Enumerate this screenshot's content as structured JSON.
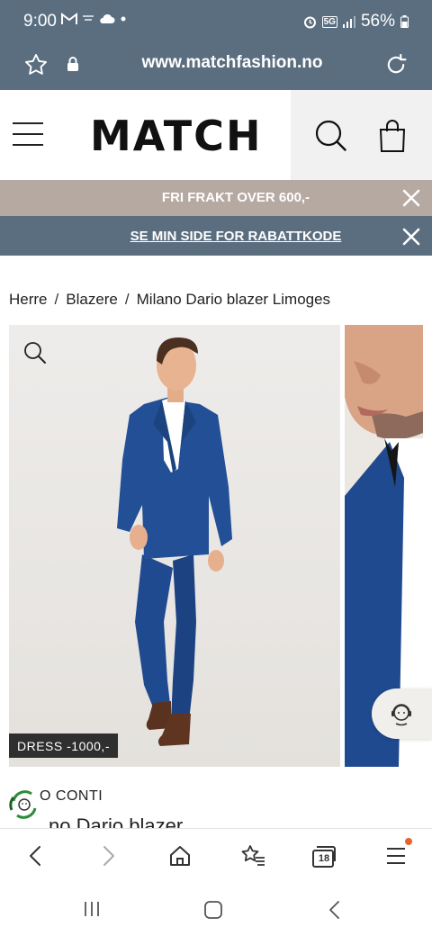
{
  "status_bar": {
    "time": "9:00",
    "battery": "56%",
    "network": "5G"
  },
  "url_bar": {
    "url": "www.matchfashion.no"
  },
  "header": {
    "logo": "MATCH"
  },
  "promos": [
    {
      "text": "FRI FRAKT OVER 600,-"
    },
    {
      "text": "SE MIN SIDE FOR RABATTKODE"
    }
  ],
  "breadcrumb": {
    "items": [
      "Herre",
      "Blazere",
      "Milano Dario blazer Limoges"
    ],
    "separator": "/"
  },
  "product": {
    "badge": "DRESS -1000,-",
    "brand": "O CONTI",
    "title": "no Dario blazer"
  },
  "colors": {
    "top_bar": "#5b6e80",
    "promo_bar": "#b6a9a1",
    "suit_blue": "#1f4a8f",
    "notification_dot": "#e8632b"
  },
  "browser_nav": {
    "tab_count": "18",
    "icons": [
      "back-icon",
      "forward-icon",
      "home-icon",
      "bookmarks-icon",
      "tabs-icon",
      "menu-icon"
    ]
  },
  "android_nav": {
    "icons": [
      "recents-icon",
      "home-icon",
      "back-icon"
    ]
  }
}
